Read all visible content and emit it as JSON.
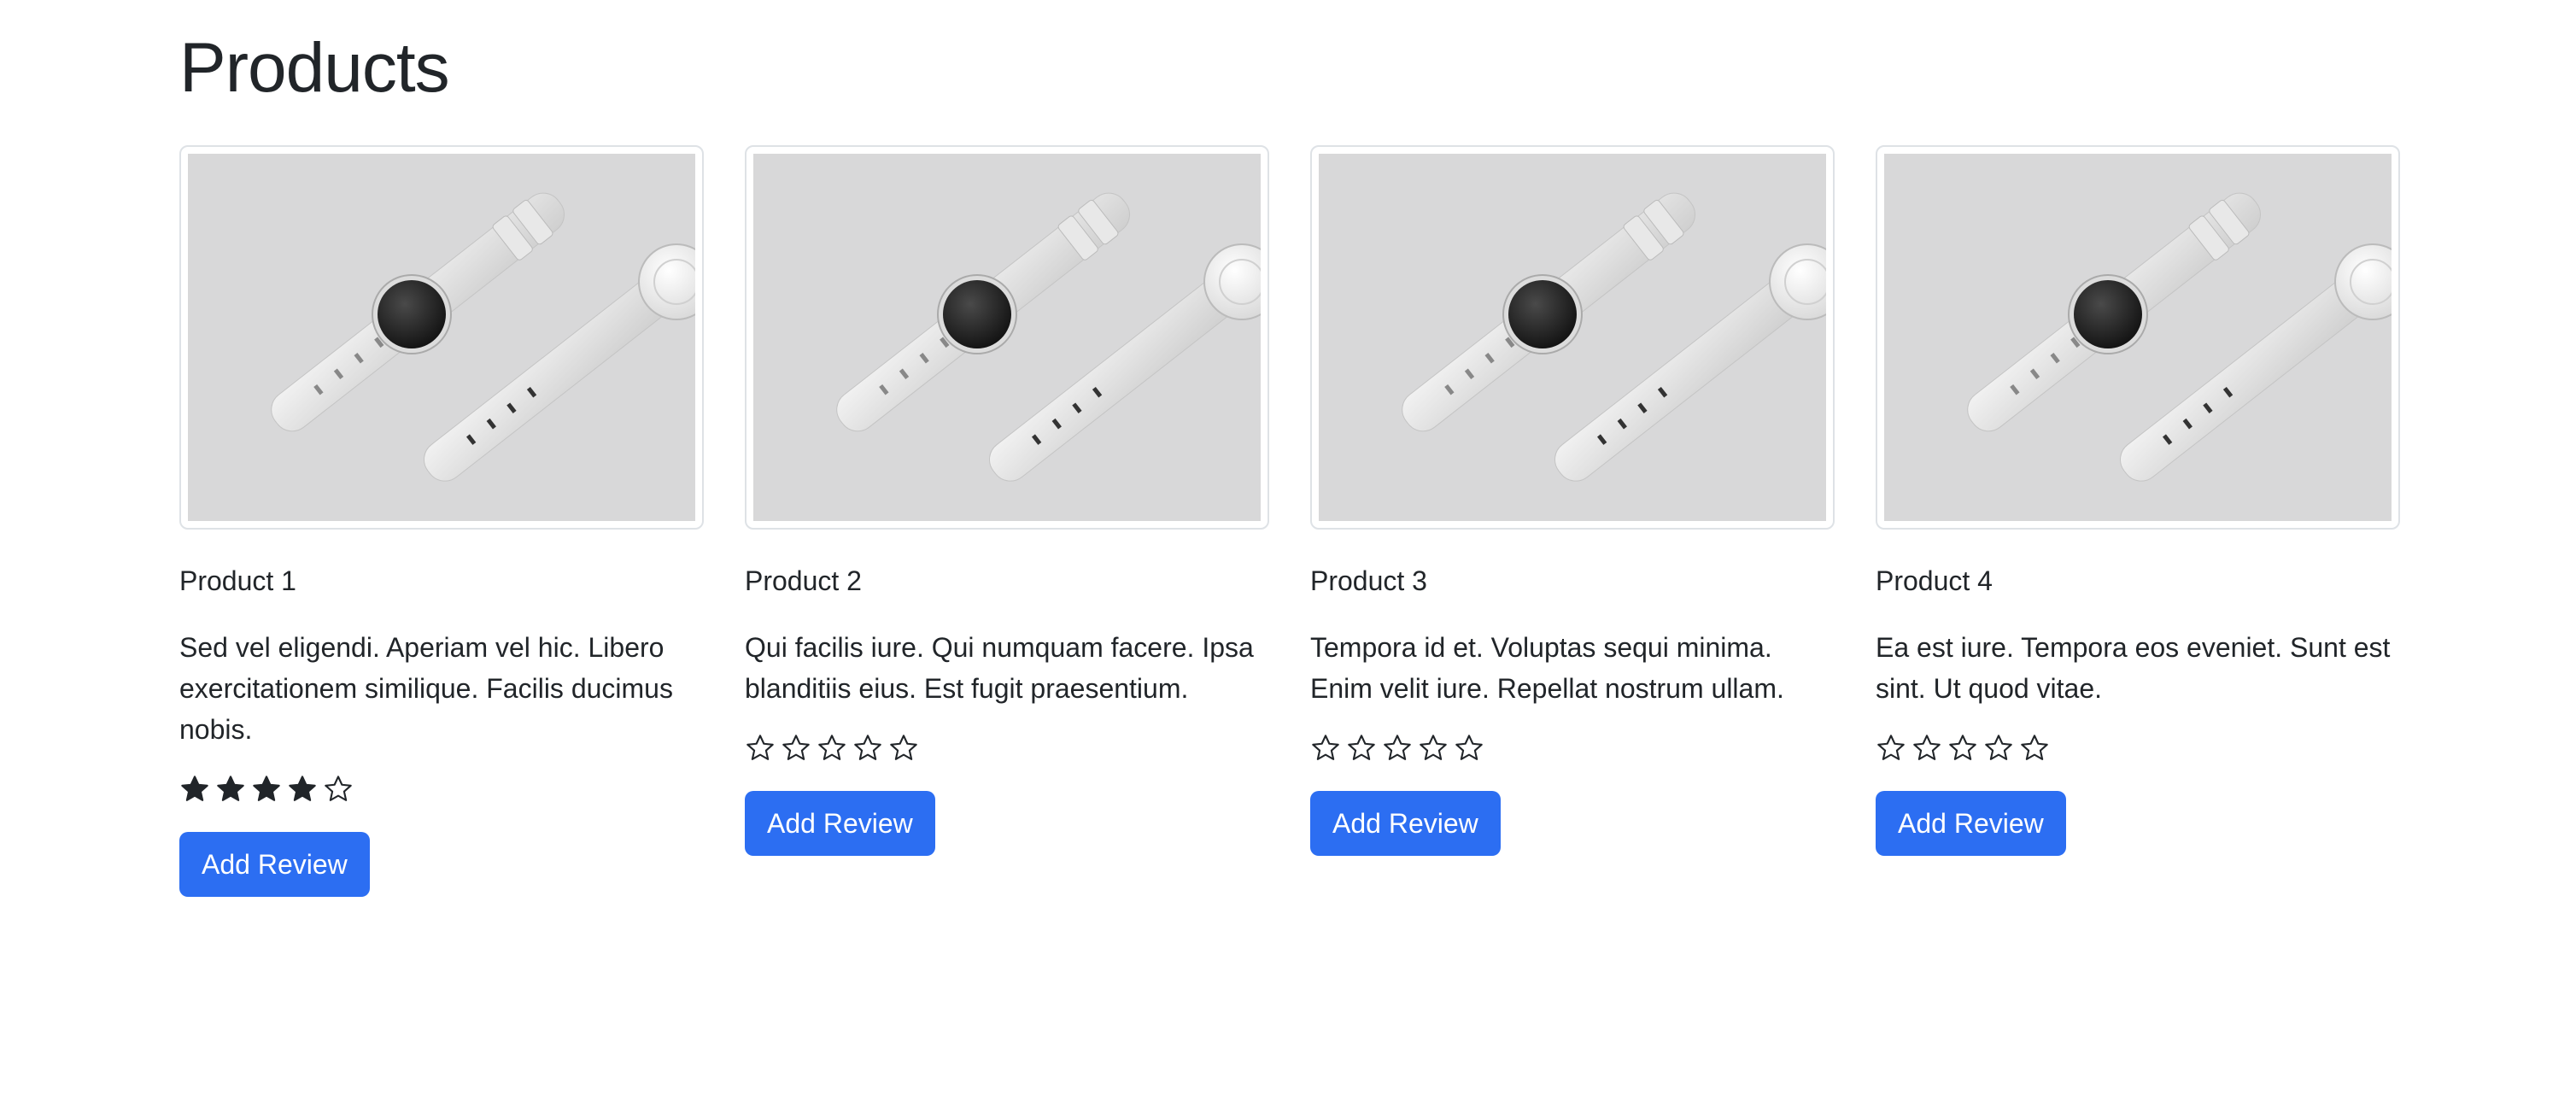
{
  "page": {
    "title": "Products"
  },
  "products": [
    {
      "name": "Product 1",
      "description": "Sed vel eligendi. Aperiam vel hic. Libero exercitationem similique. Facilis ducimus nobis.",
      "rating": 4,
      "max_rating": 5,
      "button_label": "Add Review",
      "image_icon": "smartwatch-image"
    },
    {
      "name": "Product 2",
      "description": "Qui facilis iure. Qui numquam facere. Ipsa blanditiis eius. Est fugit praesentium.",
      "rating": 0,
      "max_rating": 5,
      "button_label": "Add Review",
      "image_icon": "smartwatch-image"
    },
    {
      "name": "Product 3",
      "description": "Tempora id et. Voluptas sequi minima. Enim velit iure. Repellat nostrum ullam.",
      "rating": 0,
      "max_rating": 5,
      "button_label": "Add Review",
      "image_icon": "smartwatch-image"
    },
    {
      "name": "Product 4",
      "description": "Ea est iure. Tempora eos eveniet. Sunt est sint. Ut quod vitae.",
      "rating": 0,
      "max_rating": 5,
      "button_label": "Add Review",
      "image_icon": "smartwatch-image"
    }
  ],
  "colors": {
    "button": "#2c6ef2",
    "star": "#212529",
    "image_bg": "#d8d8d9"
  }
}
